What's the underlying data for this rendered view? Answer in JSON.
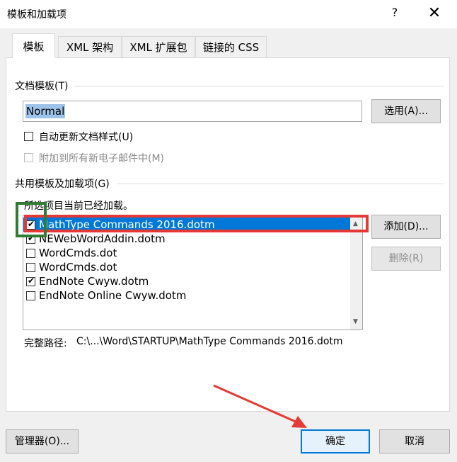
{
  "window": {
    "title": "模板和加载项",
    "help": "?",
    "close": "✕"
  },
  "tabs": [
    {
      "label": "模板"
    },
    {
      "label": "XML 架构"
    },
    {
      "label": "XML 扩展包"
    },
    {
      "label": "链接的 CSS"
    }
  ],
  "document_template": {
    "group_label": "文档模板(T)",
    "value": "Normal",
    "select_button": "选用(A)...",
    "auto_update_label": "自动更新文档样式(U)",
    "auto_update_checked": false,
    "attach_email_label": "附加到所有新电子邮件中(M)",
    "attach_email_enabled": false
  },
  "global_templates": {
    "group_label": "共用模板及加载项(G)",
    "hint": "所选项目当前已经加载。",
    "items": [
      {
        "label": "MathType Commands 2016.dotm",
        "checked": true,
        "selected": true
      },
      {
        "label": "NEWebWordAddin.dotm",
        "checked": true,
        "selected": false
      },
      {
        "label": "WordCmds.dot",
        "checked": false,
        "selected": false
      },
      {
        "label": "WordCmds.dot",
        "checked": false,
        "selected": false
      },
      {
        "label": "EndNote Cwyw.dotm",
        "checked": true,
        "selected": false
      },
      {
        "label": "EndNote Online Cwyw.dotm",
        "checked": false,
        "selected": false
      }
    ],
    "add_button": "添加(D)...",
    "remove_button": "删除(R)",
    "full_path_label": "完整路径:",
    "full_path_value": "C:\\...\\Word\\STARTUP\\MathType Commands 2016.dotm"
  },
  "footer": {
    "organizer_button": "管理器(O)...",
    "ok_button": "确定",
    "cancel_button": "取消"
  },
  "colors": {
    "accent": "#0078d7",
    "annotation_red": "#e53935",
    "annotation_green": "#2e7d32"
  }
}
